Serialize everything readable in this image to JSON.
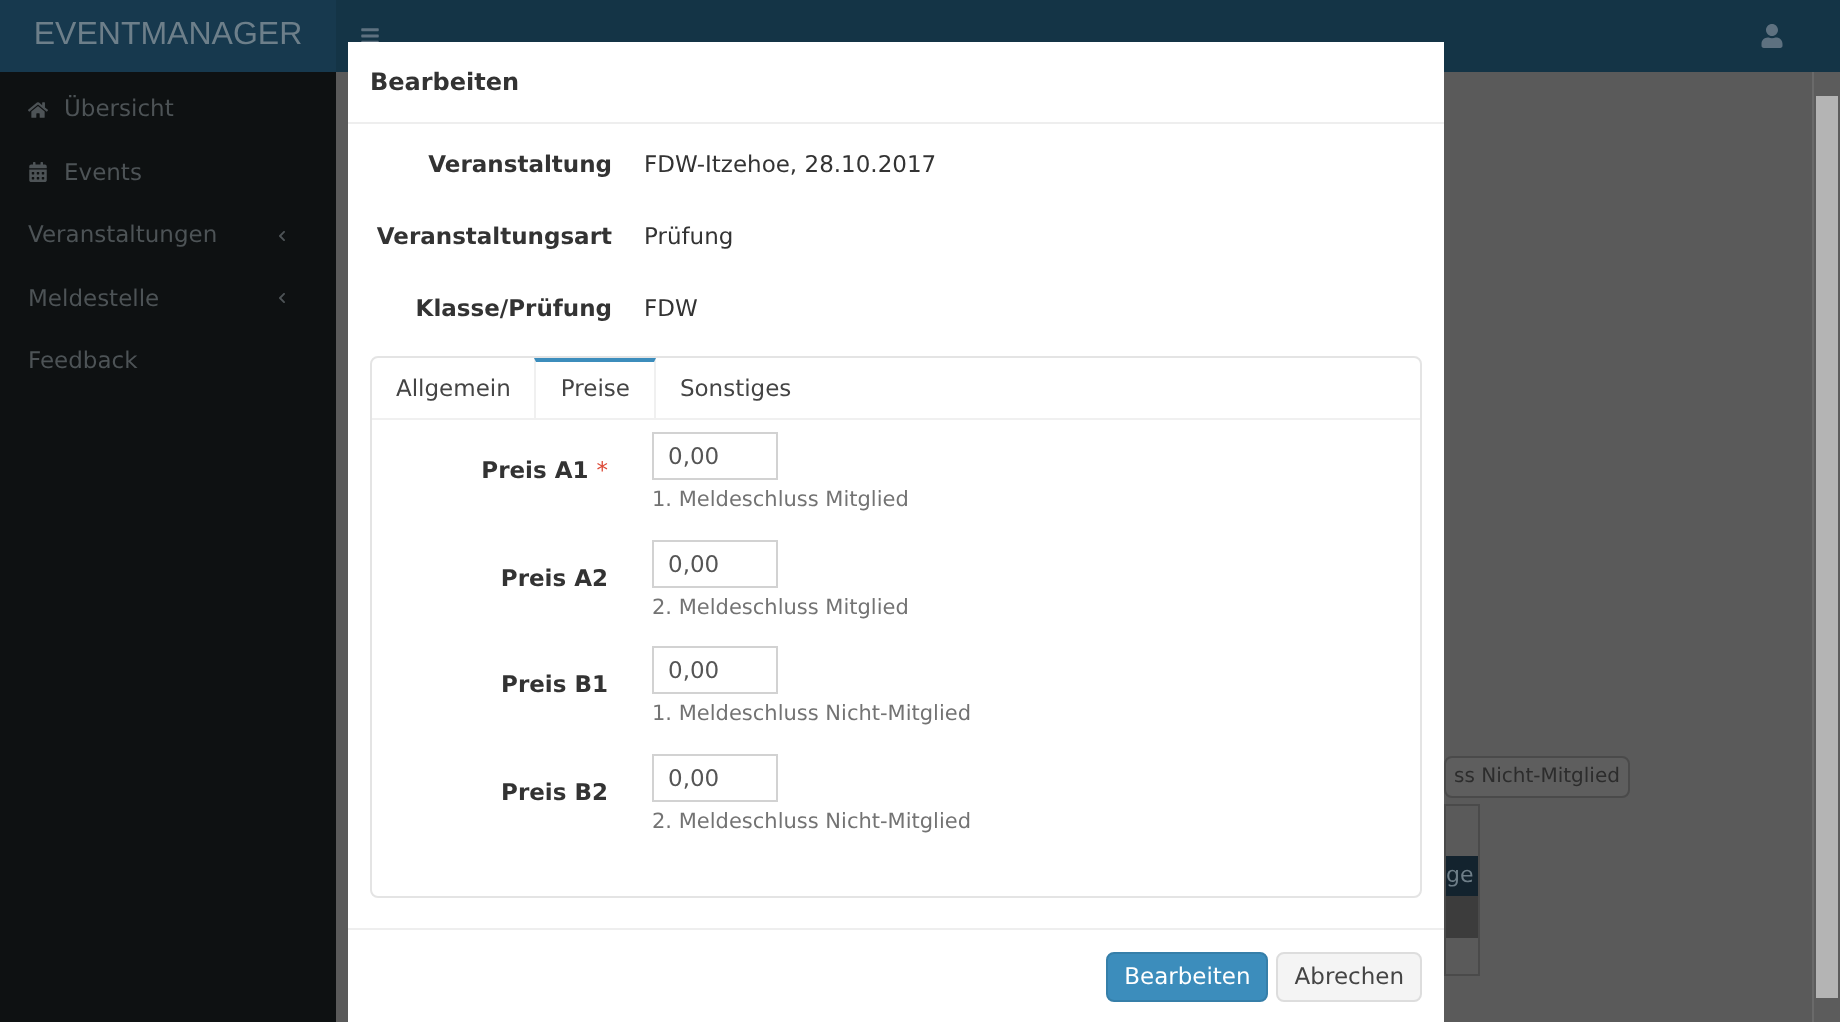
{
  "app": {
    "brand": "EVENTMANAGER"
  },
  "sidebar": {
    "items": [
      {
        "label": "Übersicht",
        "kind": "home",
        "has_submenu": false
      },
      {
        "label": "Events",
        "kind": "calendar",
        "has_submenu": false
      },
      {
        "label": "Veranstaltungen",
        "kind": "plain",
        "has_submenu": true
      },
      {
        "label": "Meldestelle",
        "kind": "plain",
        "has_submenu": true
      },
      {
        "label": "Feedback",
        "kind": "plain",
        "has_submenu": false
      }
    ]
  },
  "background": {
    "button_fragment": "ss Nicht-Mitglied",
    "table_fragment": "ge"
  },
  "dialog": {
    "title": "Bearbeiten",
    "required_symbol": "*",
    "details": [
      {
        "label": "Veranstaltung",
        "value": "FDW-Itzehoe, 28.10.2017"
      },
      {
        "label": "Veranstaltungsart",
        "value": "Prüfung"
      },
      {
        "label": "Klasse/Prüfung",
        "value": "FDW"
      }
    ],
    "tabs": [
      {
        "label": "Allgemein",
        "selected": false
      },
      {
        "label": "Preise",
        "selected": true
      },
      {
        "label": "Sonstiges",
        "selected": false
      }
    ],
    "fields": [
      {
        "label": "Preis A1",
        "required": true,
        "value": "0,00",
        "help": "1. Meldeschluss Mitglied"
      },
      {
        "label": "Preis A2",
        "required": false,
        "value": "0,00",
        "help": "2. Meldeschluss Mitglied"
      },
      {
        "label": "Preis B1",
        "required": false,
        "value": "0,00",
        "help": "1. Meldeschluss Nicht-Mitglied"
      },
      {
        "label": "Preis B2",
        "required": false,
        "value": "0,00",
        "help": "2. Meldeschluss Nicht-Mitglied"
      }
    ],
    "buttons": [
      {
        "label": "Bearbeiten",
        "kind": "primary"
      },
      {
        "label": "Abrechen",
        "kind": "default"
      }
    ]
  }
}
